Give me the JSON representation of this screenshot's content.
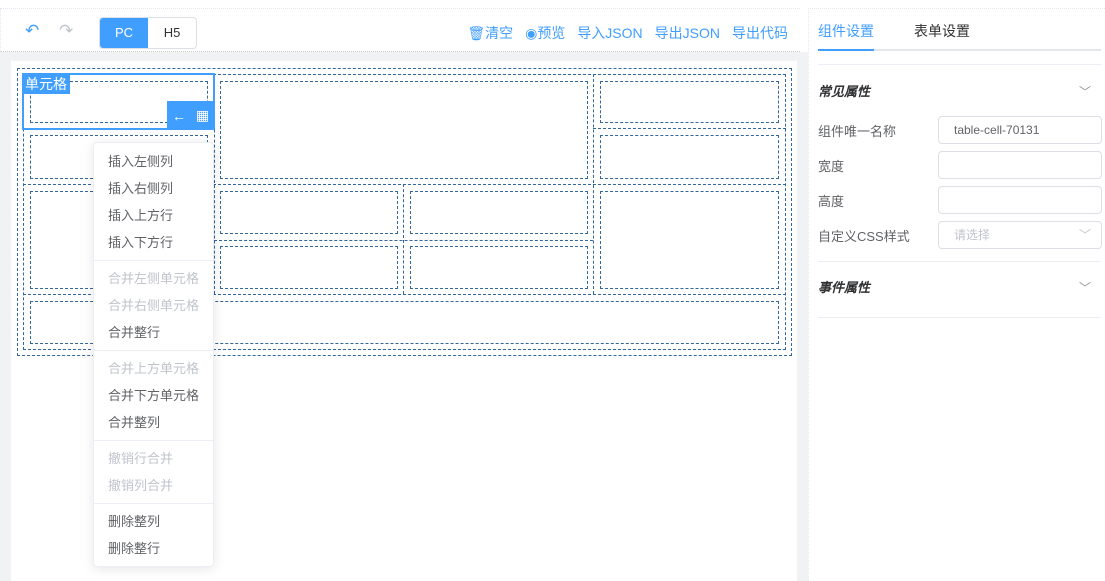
{
  "toolbar": {
    "mode_pc": "PC",
    "mode_h5": "H5",
    "clear": "清空",
    "preview": "预览",
    "import_json": "导入JSON",
    "export_json": "导出JSON",
    "export_code": "导出代码"
  },
  "canvas": {
    "selected_label": "单元格"
  },
  "context_menu": {
    "items": [
      {
        "label": "插入左侧列",
        "disabled": false
      },
      {
        "label": "插入右侧列",
        "disabled": false
      },
      {
        "label": "插入上方行",
        "disabled": false
      },
      {
        "label": "插入下方行",
        "disabled": false
      },
      {
        "label": "合并左侧单元格",
        "disabled": true
      },
      {
        "label": "合并右侧单元格",
        "disabled": true
      },
      {
        "label": "合并整行",
        "disabled": false
      },
      {
        "label": "合并上方单元格",
        "disabled": true
      },
      {
        "label": "合并下方单元格",
        "disabled": false
      },
      {
        "label": "合并整列",
        "disabled": false
      },
      {
        "label": "撤销行合并",
        "disabled": true
      },
      {
        "label": "撤销列合并",
        "disabled": true
      },
      {
        "label": "删除整列",
        "disabled": false
      },
      {
        "label": "删除整行",
        "disabled": false
      }
    ]
  },
  "panel": {
    "tabs": [
      "组件设置",
      "表单设置"
    ],
    "common_section": "常见属性",
    "event_section": "事件属性",
    "fields": {
      "name_label": "组件唯一名称",
      "name_value": "table-cell-70131",
      "width_label": "宽度",
      "height_label": "高度",
      "css_label": "自定义CSS样式",
      "css_placeholder": "请选择"
    }
  },
  "colors": {
    "accent": "#409eff",
    "dash": "#336699"
  }
}
